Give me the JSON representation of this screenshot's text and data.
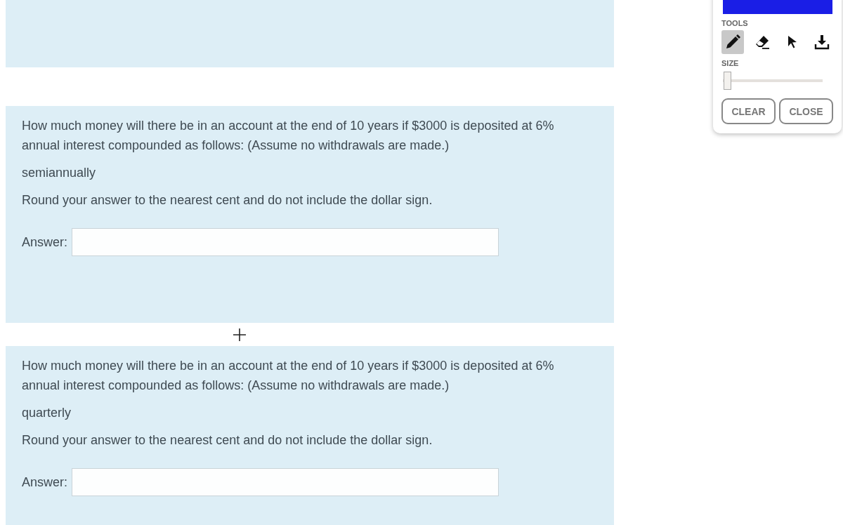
{
  "questions": [
    {
      "prompt": "How much money will there be in an account at the end of 10 years if $3000 is deposited at 6% annual interest compounded as follows: (Assume no withdrawals are made.)",
      "frequency": "semiannually",
      "instruction": "Round your answer to the nearest cent and do not include the dollar sign.",
      "answer_label": "Answer:"
    },
    {
      "prompt": "How much money will there be in an account at the end of 10 years if $3000 is deposited at 6% annual interest compounded as follows: (Assume no withdrawals are made.)",
      "frequency": "quarterly",
      "instruction": "Round your answer to the nearest cent and do not include the dollar sign.",
      "answer_label": "Answer:"
    }
  ],
  "drawing_panel": {
    "tools_label": "TOOLS",
    "tools": [
      {
        "kind": "pencil",
        "selected": true
      },
      {
        "kind": "eraser",
        "selected": false
      },
      {
        "kind": "pointer",
        "selected": false
      },
      {
        "kind": "download",
        "selected": false
      }
    ],
    "size_label": "SIZE",
    "size": {
      "level": 0.04
    },
    "buttons": [
      "CLEAR",
      "CLOSE"
    ]
  }
}
